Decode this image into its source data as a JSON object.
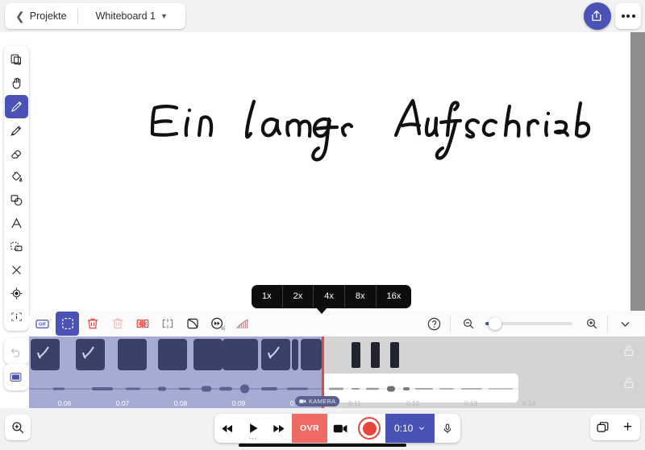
{
  "topbar": {
    "back_label": "Projekte",
    "back_icon": "chevron-left-icon",
    "title": "Whiteboard 1",
    "title_chevron": "chevron-down-icon",
    "share_icon": "share-icon",
    "more_icon": "more-dots-icon"
  },
  "canvas": {
    "handwriting_text": "Ein langer Aufschrieb",
    "background": "#ffffff"
  },
  "left_toolbar": {
    "items": [
      {
        "name": "add-page-tool",
        "icon": "add-page-icon",
        "active": false
      },
      {
        "name": "hand-tool",
        "icon": "hand-icon",
        "active": false
      },
      {
        "name": "pen-tool",
        "icon": "pen-icon",
        "active": true
      },
      {
        "name": "marker-tool",
        "icon": "marker-icon",
        "active": false
      },
      {
        "name": "eraser-tool",
        "icon": "eraser-icon",
        "active": false
      },
      {
        "name": "fill-tool",
        "icon": "paint-bucket-icon",
        "active": false
      },
      {
        "name": "shape-tool",
        "icon": "shapes-icon",
        "active": false
      },
      {
        "name": "text-tool",
        "icon": "text-a-icon",
        "active": false
      },
      {
        "name": "select-tool",
        "icon": "marquee-select-icon",
        "active": false
      },
      {
        "name": "clear-tool",
        "icon": "close-x-icon",
        "active": false
      },
      {
        "name": "laser-tool",
        "icon": "target-icon",
        "active": false
      },
      {
        "name": "inspect-tool",
        "icon": "inspect-info-icon",
        "active": false
      }
    ],
    "undo": {
      "name": "undo-button",
      "icon": "undo-arrow-icon",
      "disabled": true
    },
    "frame": {
      "name": "frame-button",
      "icon": "frame-icon",
      "disabled": false
    }
  },
  "speed_popup": {
    "options": [
      "1x",
      "2x",
      "4x",
      "8x",
      "16x"
    ],
    "selected": "4x"
  },
  "timeline": {
    "toolbar_icons": [
      {
        "name": "gif-export-button",
        "icon": "gif-icon",
        "selected": false
      },
      {
        "name": "range-select-button",
        "icon": "dashed-marquee-icon",
        "selected": true
      },
      {
        "name": "delete-button",
        "icon": "trash-icon",
        "selected": false
      },
      {
        "name": "delete-all-button",
        "icon": "trash-faded-icon",
        "selected": false
      },
      {
        "name": "split-button",
        "icon": "split-clip-icon",
        "selected": false
      },
      {
        "name": "cut-button",
        "icon": "cut-clip-icon",
        "selected": false
      },
      {
        "name": "fade-button",
        "icon": "fade-icon",
        "selected": false
      },
      {
        "name": "speed-button",
        "icon": "speed-x2-icon",
        "selected": false
      },
      {
        "name": "audio-levels-button",
        "icon": "levels-bars-icon",
        "selected": false
      }
    ],
    "help_icon": "question-mark-icon",
    "zoom_out_icon": "zoom-out-icon",
    "zoom_in_icon": "zoom-in-icon",
    "collapse_icon": "chevron-down-icon",
    "zoom_value": 5,
    "ruler_ticks": [
      "0:06",
      "0:07",
      "0:08",
      "0:09",
      "0:10",
      "0:11",
      "0:12",
      "0:13",
      "0:14"
    ],
    "playhead_time": "0:10",
    "camera_track_label": "KAMERA",
    "lock_icon": "unlocked-padlock-icon",
    "selection_color": "#a6abd4",
    "thumbnail_color": "#3b4068",
    "playhead_color": "#e8453c"
  },
  "bottombar": {
    "canvas_zoom_icon": "zoom-in-magnifier-icon",
    "rewind_icon": "rewind-icon",
    "play_icon": "play-icon",
    "play_sub": "...",
    "forward_icon": "fast-forward-icon",
    "ovr_label": "OVR",
    "camera_icon": "video-camera-icon",
    "record_icon": "record-circle-icon",
    "time_label": "0:10",
    "time_chevron": "chevron-down-icon",
    "mic_icon": "microphone-icon",
    "pages_icon": "pages-stack-icon",
    "add_page_label": "+"
  },
  "colors": {
    "accent": "#4a52b5",
    "record_red": "#e8453c",
    "ovr_red": "#ef6a63",
    "chrome": "#f2f2f2",
    "timeline_bg": "#d4d4d4"
  }
}
